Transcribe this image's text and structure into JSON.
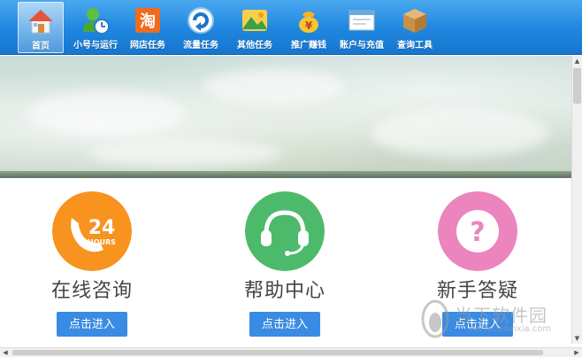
{
  "toolbar": {
    "items": [
      {
        "label": "首页",
        "icon": "house-icon",
        "active": true
      },
      {
        "label": "小号与运行",
        "icon": "user-clock-icon",
        "active": false
      },
      {
        "label": "网店任务",
        "icon": "taobao-icon",
        "active": false
      },
      {
        "label": "流量任务",
        "icon": "refresh-icon",
        "active": false
      },
      {
        "label": "其他任务",
        "icon": "mountain-icon",
        "active": false
      },
      {
        "label": "推广赚钱",
        "icon": "money-bag-icon",
        "active": false
      },
      {
        "label": "账户与充值",
        "icon": "window-icon",
        "active": false
      },
      {
        "label": "查询工具",
        "icon": "box-icon",
        "active": false
      }
    ]
  },
  "cards": [
    {
      "title": "在线咨询",
      "button": "点击进入",
      "icon": "phone-24-hours-icon",
      "icon_text": "24",
      "icon_sub": "HOURS",
      "color": "#f7931e"
    },
    {
      "title": "帮助中心",
      "button": "点击进入",
      "icon": "headset-icon",
      "color": "#4cba6a"
    },
    {
      "title": "新手答疑",
      "button": "点击进入",
      "icon": "question-icon",
      "icon_text": "?",
      "color": "#ec84be"
    }
  ],
  "watermark": {
    "text": "当下软件园",
    "url": "www.downxia.com"
  },
  "colors": {
    "toolbar": "#1f86de",
    "button": "#3a8be3"
  }
}
